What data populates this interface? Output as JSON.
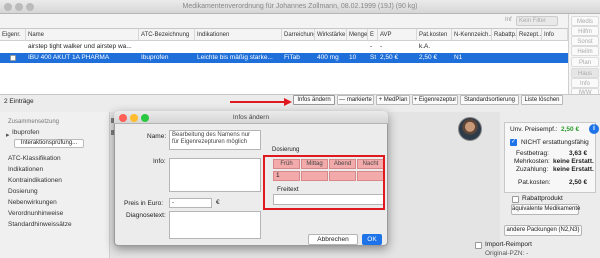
{
  "window": {
    "title": "Medikamentenverordnung für Johannes Zollmann, 08.02.1999 (19J) (90 kg)"
  },
  "toolbar": {
    "filter_label": "Inf",
    "filter_value": "Kein Filter"
  },
  "sidetabs": [
    "Medis",
    "Hilfm",
    "Sonst",
    "Heilm",
    "Plan",
    "Haus",
    "Info",
    "IWW"
  ],
  "table": {
    "columns": [
      "Eigenr.",
      "Name",
      "ATC-Bezeichnung",
      "Indikationen",
      "Darreichung",
      "Wirkstärke",
      "Menge",
      "E",
      "AVP",
      "Pat.kosten",
      "N-Kennzeich..",
      "Rabattp..",
      "Rezept...",
      "Info"
    ],
    "rows": [
      {
        "name": "airstep tight walker und airstep wa...",
        "atc": "",
        "indikation": "",
        "darreichung": "",
        "wirkstaerke": "",
        "menge": "",
        "e": "-",
        "avp": "-",
        "patkosten": "k.A.",
        "nkenn": "",
        "selected": false
      },
      {
        "name": "IBU 400 AKUT 1A PHARMA",
        "atc": "Ibuprofen",
        "indikation": "Leichte bis mäßig starke...",
        "darreichung": "FiTab",
        "wirkstaerke": "400 mg",
        "menge": "10",
        "e": "St",
        "avp": "2,50 €",
        "patkosten": "2,50 €",
        "nkenn": "N1",
        "selected": true
      }
    ]
  },
  "statusbar": {
    "entries": "2 Einträge",
    "buttons": [
      "Infos ändern",
      "— markierte",
      "+ MedPlan",
      "+ Eigenrezeptur",
      "Standardsortierung",
      "Liste löschen"
    ]
  },
  "leftpanel": {
    "heading": "Zusammensetzung",
    "ingredient": "Ibuprofen",
    "interaction_button": "Interaktionsprüfung...",
    "items": [
      "ATC-Klassifikation",
      "Indikationen",
      "Kontraindikationen",
      "Dosierung",
      "Nebenwirkungen",
      "Verordnunhinweise",
      "Standardhinweissätze"
    ]
  },
  "behind": {
    "ib1": "IB",
    "ib2": "IB"
  },
  "dialog": {
    "title": "Infos ändern",
    "name_label": "Name:",
    "name_value": "Bearbeitung des Namens nur für Eigenrezepturen möglich",
    "info_label": "Info:",
    "info_value": "",
    "price_label": "Preis in Euro:",
    "price_value": "-",
    "currency": "€",
    "diag_label": "Diagnosetext:",
    "diag_value": "",
    "dosage_label": "Dosierung",
    "dose_headers": [
      "Früh",
      "Mittag",
      "Abend",
      "Nacht"
    ],
    "dose_values": [
      "1",
      "",
      "",
      ""
    ],
    "freitext_label": "Freitext",
    "freitext_value": "",
    "cancel": "Abbrechen",
    "ok": "OK"
  },
  "rightpanel": {
    "preis_label": "Unv. Preisempf.:",
    "preis_value": "2,50 €",
    "nicht_label": "NICHT erstattungsfähig",
    "festbetrag_label": "Festbetrag:",
    "festbetrag_value": "3,63 €",
    "mehrkosten_label": "Mehrkosten:",
    "mehrkosten_value": "keine Erstatt.",
    "zuzahlung_label": "Zuzahlung:",
    "zuzahlung_value": "keine Erstatt.",
    "patkosten_label": "Pat.kosten:",
    "patkosten_value": "2,50 €",
    "rabatt_label": "Rabattprodukt",
    "aequivalent_button": "äquivalente Medikamente",
    "packungen_button": "andere Packungen (N2,N3)",
    "import_label": "Import-Reimport",
    "original_label": "Original-PZN: -"
  },
  "colors": {
    "accent": "#1e6fd9",
    "highlight": "#e0191f",
    "dose_fill": "#f2aaaa",
    "price_green": "#2a9a2a"
  }
}
